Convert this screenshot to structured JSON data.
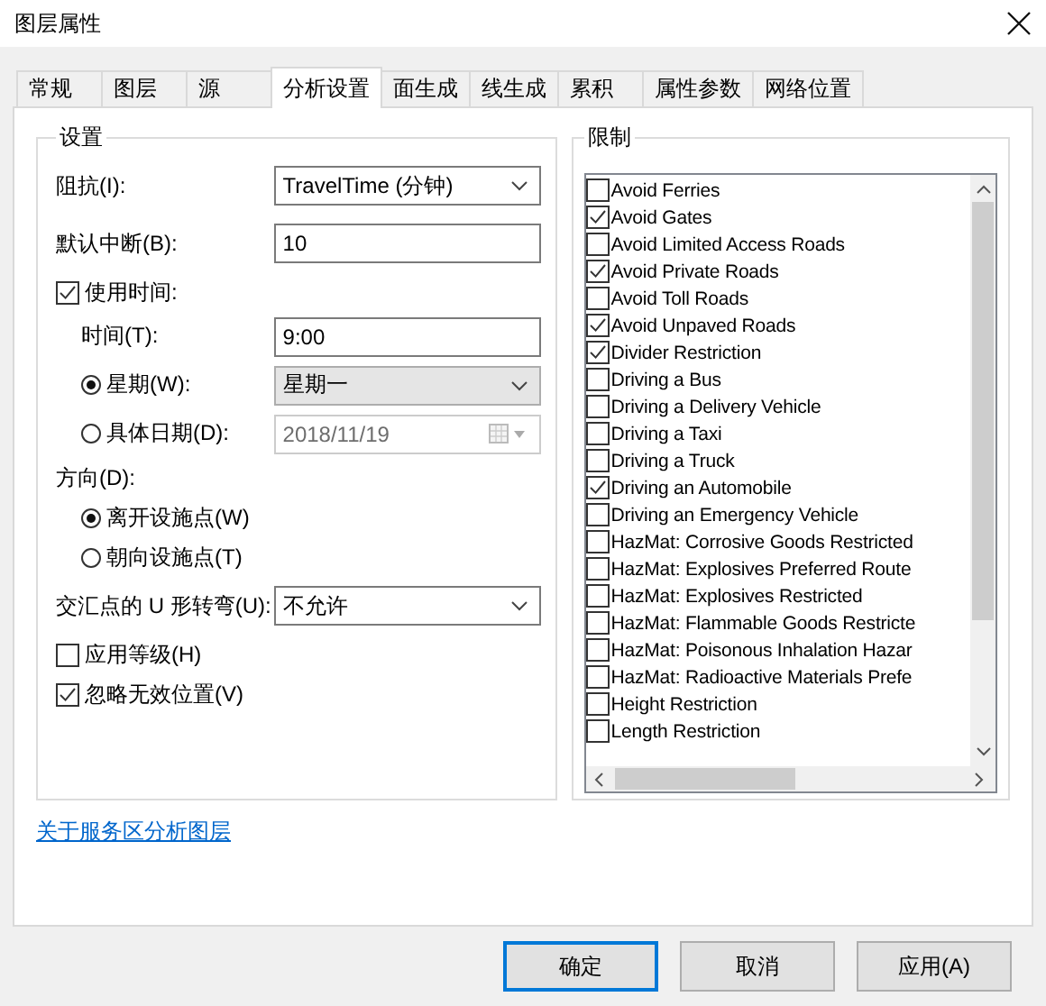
{
  "window": {
    "title": "图层属性"
  },
  "tabs": [
    {
      "label": "常规",
      "selected": false
    },
    {
      "label": "图层",
      "selected": false
    },
    {
      "label": "源",
      "selected": false
    },
    {
      "label": "分析设置",
      "selected": true
    },
    {
      "label": "面生成",
      "selected": false
    },
    {
      "label": "线生成",
      "selected": false
    },
    {
      "label": "累积",
      "selected": false
    },
    {
      "label": "属性参数",
      "selected": false
    },
    {
      "label": "网络位置",
      "selected": false
    }
  ],
  "settings": {
    "title": "设置",
    "rows": [
      {
        "kind": "select",
        "label": "阻抗(I):",
        "value": "TravelTime (分钟)"
      },
      {
        "kind": "input",
        "label": "默认中断(B):",
        "value": "10"
      },
      {
        "kind": "checkbox",
        "label": "使用时间:",
        "checked": true,
        "children": [
          {
            "kind": "input",
            "label": "时间(T):",
            "value": "9:00"
          },
          {
            "kind": "radio",
            "label": "星期(W):",
            "selected": true,
            "field": {
              "kind": "select",
              "value": "星期一",
              "disabled": false
            }
          },
          {
            "kind": "radio",
            "label": "具体日期(D):",
            "selected": false,
            "field": {
              "kind": "date",
              "value": "2018/11/19",
              "disabled": true
            }
          }
        ]
      },
      {
        "kind": "heading",
        "label": "方向(D):",
        "children": [
          {
            "kind": "radio",
            "label": "离开设施点(W)",
            "selected": true
          },
          {
            "kind": "radio",
            "label": "朝向设施点(T)",
            "selected": false
          }
        ]
      },
      {
        "kind": "select",
        "label": "交汇点的 U 形转弯(U):",
        "value": "不允许"
      },
      {
        "kind": "checkbox",
        "label": "应用等级(H)",
        "checked": false
      },
      {
        "kind": "checkbox",
        "label": "忽略无效位置(V)",
        "checked": true
      }
    ]
  },
  "link": "关于服务区分析图层",
  "restrictions": {
    "title": "限制",
    "items": [
      {
        "label": "Avoid Ferries",
        "checked": false
      },
      {
        "label": "Avoid Gates",
        "checked": true
      },
      {
        "label": "Avoid Limited Access Roads",
        "checked": false
      },
      {
        "label": "Avoid Private Roads",
        "checked": true
      },
      {
        "label": "Avoid Toll Roads",
        "checked": false
      },
      {
        "label": "Avoid Unpaved Roads",
        "checked": true
      },
      {
        "label": "Divider Restriction",
        "checked": true
      },
      {
        "label": "Driving a Bus",
        "checked": false
      },
      {
        "label": "Driving a Delivery Vehicle",
        "checked": false
      },
      {
        "label": "Driving a Taxi",
        "checked": false
      },
      {
        "label": "Driving a Truck",
        "checked": false
      },
      {
        "label": "Driving an Automobile",
        "checked": true
      },
      {
        "label": "Driving an Emergency Vehicle",
        "checked": false
      },
      {
        "label": "HazMat: Corrosive Goods Restricted",
        "checked": false
      },
      {
        "label": "HazMat: Explosives Preferred Route",
        "checked": false
      },
      {
        "label": "HazMat: Explosives Restricted",
        "checked": false
      },
      {
        "label": "HazMat: Flammable Goods Restricte",
        "checked": false
      },
      {
        "label": "HazMat: Poisonous Inhalation Hazar",
        "checked": false
      },
      {
        "label": "HazMat: Radioactive Materials Prefe",
        "checked": false
      },
      {
        "label": "Height Restriction",
        "checked": false
      },
      {
        "label": "Length Restriction",
        "checked": false
      }
    ]
  },
  "buttons": [
    {
      "label": "确定",
      "default": true
    },
    {
      "label": "取消",
      "default": false
    },
    {
      "label": "应用(A)",
      "default": false
    }
  ]
}
